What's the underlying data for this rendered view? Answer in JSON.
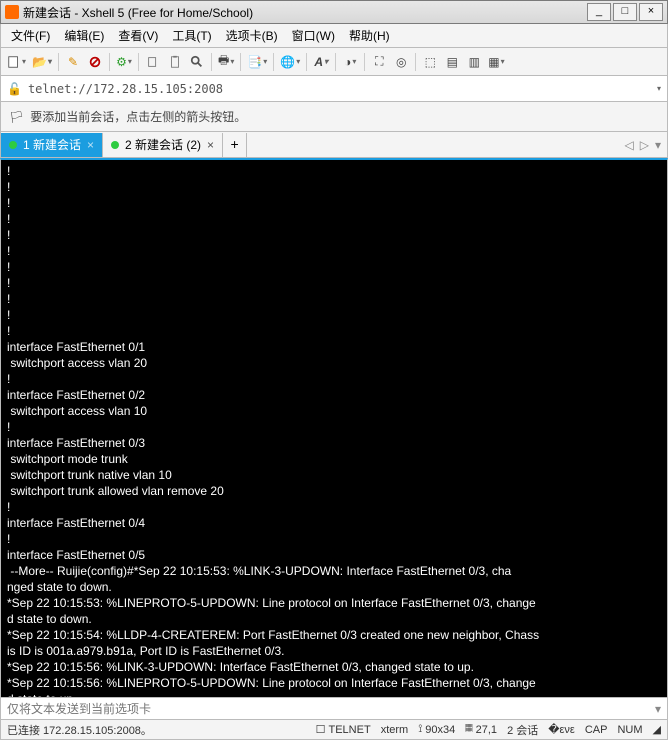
{
  "title": "新建会话 - Xshell 5 (Free for Home/School)",
  "menu": {
    "file": "文件(F)",
    "edit": "编辑(E)",
    "view": "查看(V)",
    "tools": "工具(T)",
    "tabs": "选项卡(B)",
    "window": "窗口(W)",
    "help": "帮助(H)"
  },
  "address": {
    "value": "telnet://172.28.15.105:2008"
  },
  "hint": "要添加当前会话，点击左侧的箭头按钮。",
  "tabs": [
    {
      "label": "1 新建会话",
      "active": true
    },
    {
      "label": "2 新建会话 (2)",
      "active": false
    }
  ],
  "terminal": "!\n!\n!\n!\n!\n!\n!\n!\n!\n!\n!\ninterface FastEthernet 0/1\n switchport access vlan 20\n!\ninterface FastEthernet 0/2\n switchport access vlan 10\n!\ninterface FastEthernet 0/3\n switchport mode trunk\n switchport trunk native vlan 10\n switchport trunk allowed vlan remove 20\n!\ninterface FastEthernet 0/4\n!\ninterface FastEthernet 0/5\n --More-- Ruijie(config)#*Sep 22 10:15:53: %LINK-3-UPDOWN: Interface FastEthernet 0/3, cha\nnged state to down.\n*Sep 22 10:15:53: %LINEPROTO-5-UPDOWN: Line protocol on Interface FastEthernet 0/3, change\nd state to down.\n*Sep 22 10:15:54: %LLDP-4-CREATEREM: Port FastEthernet 0/3 created one new neighbor, Chass\nis ID is 001a.a979.b91a, Port ID is FastEthernet 0/3.\n*Sep 22 10:15:56: %LINK-3-UPDOWN: Interface FastEthernet 0/3, changed state to up.\n*Sep 22 10:15:56: %LINEPROTO-5-UPDOWN: Line protocol on Interface FastEthernet 0/3, change\nd state to up.",
  "send_placeholder": "仅将文本发送到当前选项卡",
  "status": {
    "conn": "已连接 172.28.15.105:2008。",
    "proto": "TELNET",
    "term": "xterm",
    "size": "90x34",
    "pos": "27,1",
    "sessions": "2 会话",
    "cap": "CAP",
    "num": "NUM"
  }
}
